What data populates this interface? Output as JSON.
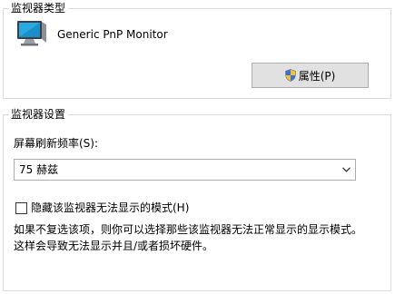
{
  "monitor_type": {
    "title": "监视器类型",
    "icon": "monitor-icon",
    "name": "Generic PnP Monitor",
    "properties_button": {
      "label": "属性(P)",
      "icon": "uac-shield-icon"
    }
  },
  "monitor_settings": {
    "title": "监视器设置",
    "refresh_label": "屏幕刷新频率(S):",
    "refresh_select": {
      "value": "75 赫兹",
      "icon": "chevron-down-icon"
    },
    "hide_modes_checkbox": {
      "label": "隐藏该监视器无法显示的模式(H)",
      "checked": false
    },
    "help_text": [
      "如果不复选该项，则你可以选择那些该监视器无法正常显示的显示模式。",
      "这样会导致无法显示并且/或者损坏硬件。"
    ]
  },
  "colors": {
    "border": "#dcdcdc",
    "button_bg": "#e1e1e1",
    "button_border": "#adadad",
    "shield_blue": "#3a6fd8",
    "shield_yellow": "#f2c230"
  }
}
